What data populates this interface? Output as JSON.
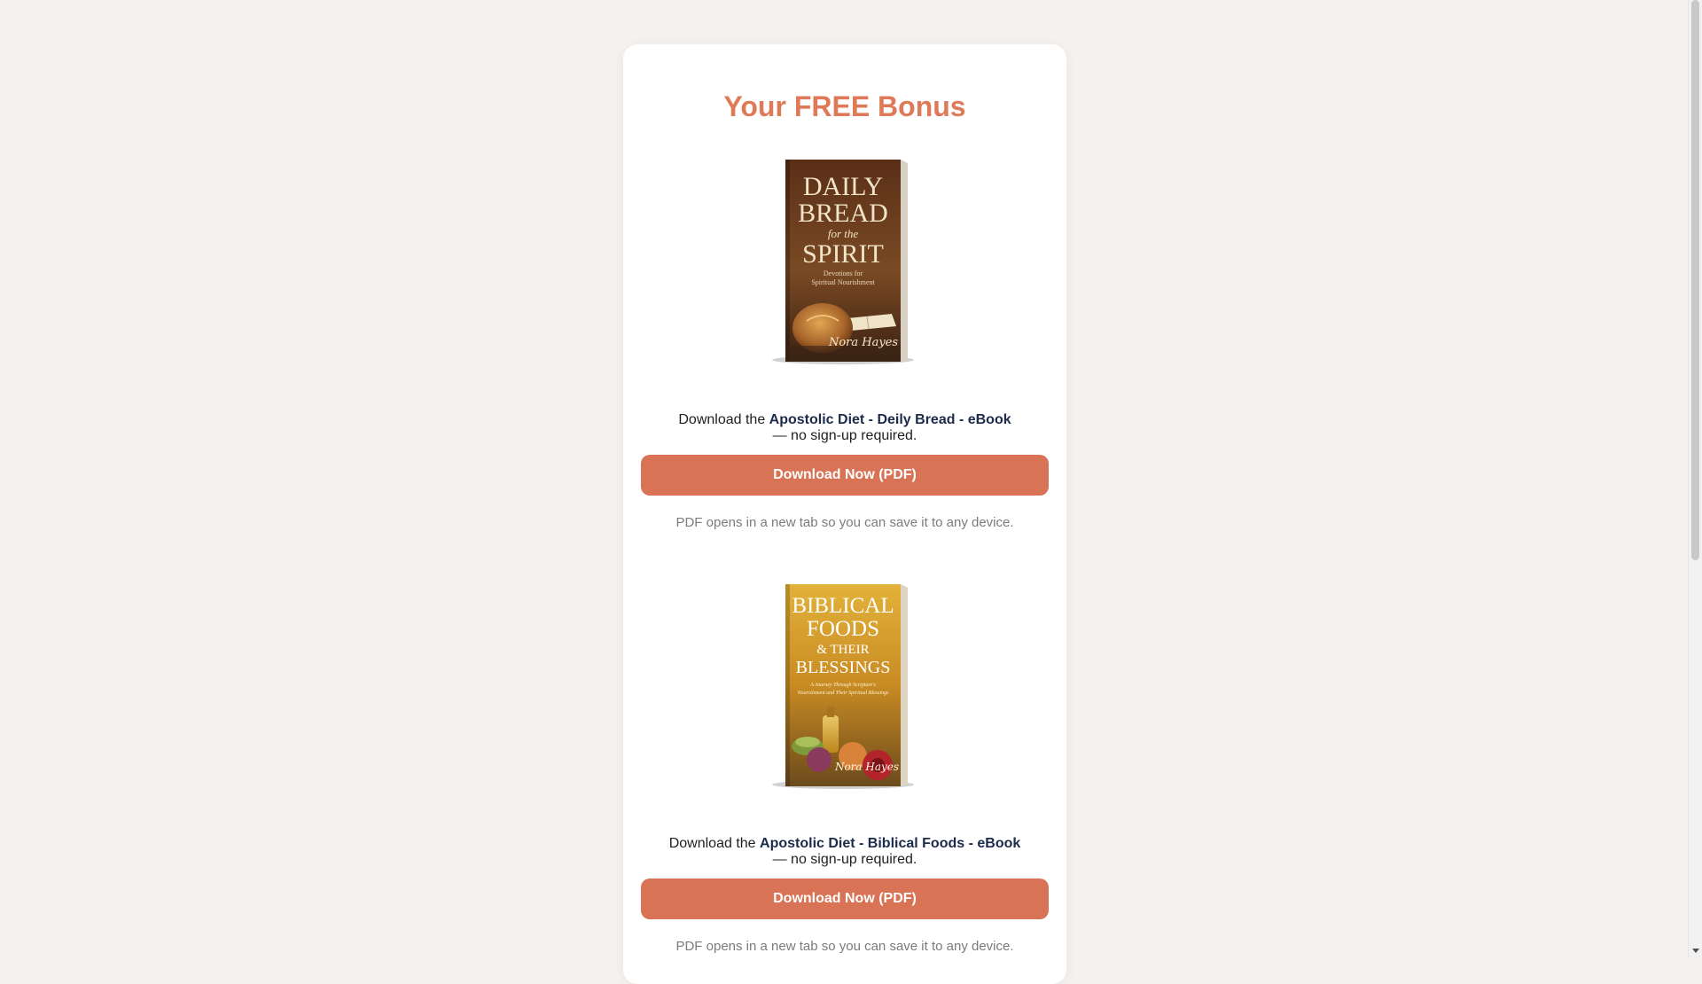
{
  "page": {
    "title": "Your FREE Bonus"
  },
  "colors": {
    "accent": "#d97356",
    "title": "#df7a58",
    "page_bg": "#f4f1ee"
  },
  "offers": [
    {
      "cover": {
        "line1": "DAILY",
        "line2": "BREAD",
        "line3": "for the",
        "line4": "SPIRIT",
        "subtitle1": "Devotions for",
        "subtitle2": "Spiritual Nourishment",
        "author": "Nora Hayes"
      },
      "lead": "Download the",
      "product": "Apostolic Diet - Deily Bread - eBook",
      "tail": "— no sign-up required.",
      "button": "Download Now (PDF)",
      "note": "PDF opens in a new tab so you can save it to any device."
    },
    {
      "cover": {
        "line1": "BIBLICAL",
        "line2": "FOODS",
        "line3": "& THEIR",
        "line4": "BLESSINGS",
        "subtitle1": "A Journey Through Scripture's",
        "subtitle2": "Nourishment and Their Spiritual Blessings",
        "author": "Nora Hayes"
      },
      "lead": "Download the",
      "product": "Apostolic Diet - Biblical Foods - eBook",
      "tail": "— no sign-up required.",
      "button": "Download Now (PDF)",
      "note": "PDF opens in a new tab so you can save it to any device."
    }
  ]
}
